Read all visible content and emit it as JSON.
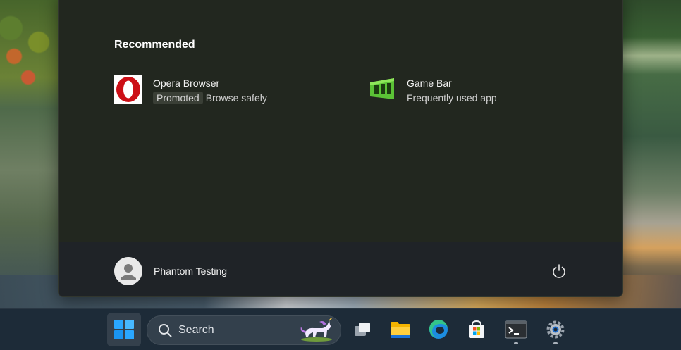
{
  "start_menu": {
    "recommended_title": "Recommended",
    "recommended": [
      {
        "name": "Opera Browser",
        "badge": "Promoted",
        "subtitle": "Browse safely",
        "icon": "opera-icon"
      },
      {
        "name": "Game Bar",
        "subtitle": "Frequently used app",
        "icon": "game-bar-icon"
      }
    ],
    "footer": {
      "user_name": "Phantom Testing",
      "avatar_icon": "user-avatar-icon",
      "power_icon": "power-icon"
    }
  },
  "taskbar": {
    "search_placeholder": "Search",
    "apps": [
      {
        "name": "Start",
        "icon": "windows-start-icon"
      },
      {
        "name": "Task View",
        "icon": "task-view-icon"
      },
      {
        "name": "File Explorer",
        "icon": "file-explorer-icon"
      },
      {
        "name": "Microsoft Edge",
        "icon": "edge-icon"
      },
      {
        "name": "Microsoft Store",
        "icon": "store-icon"
      },
      {
        "name": "Terminal",
        "icon": "terminal-icon",
        "running": true
      },
      {
        "name": "Settings",
        "icon": "settings-gear-icon",
        "running": true
      }
    ]
  },
  "colors": {
    "opera_red": "#cc0f16",
    "game_bar_green": "#5bc236",
    "windows_blue": "#2aa7ff"
  }
}
